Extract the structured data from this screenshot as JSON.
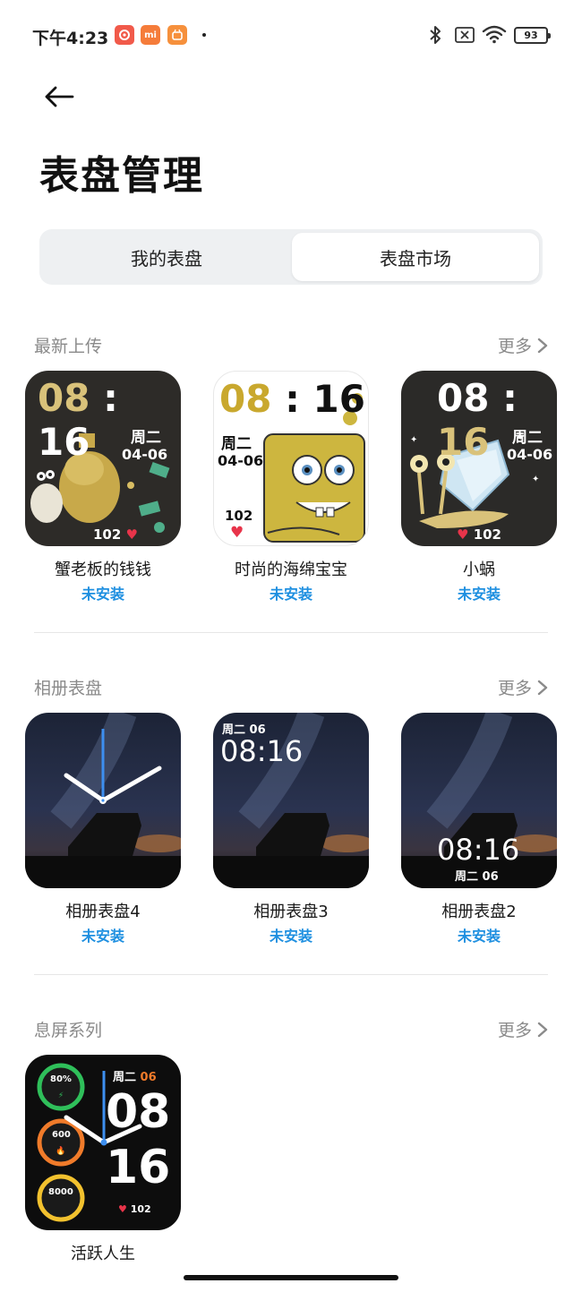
{
  "status_bar": {
    "time": "下午4:23",
    "battery": "93",
    "notif_2_label": "mi"
  },
  "header": {
    "title": "表盘管理"
  },
  "tabs": [
    {
      "label": "我的表盘"
    },
    {
      "label": "表盘市场"
    }
  ],
  "sections": [
    {
      "title": "最新上传",
      "more": "更多",
      "faces": [
        {
          "name": "蟹老板的钱钱",
          "status": "未安装",
          "time_h": "08",
          "time_m": "16",
          "weekday": "周二",
          "date": "04-06",
          "hr": "102"
        },
        {
          "name": "时尚的海绵宝宝",
          "status": "未安装",
          "time_h": "08",
          "time_m": "16",
          "weekday": "周二",
          "date": "04-06",
          "hr": "102"
        },
        {
          "name": "小蜗",
          "status": "未安装",
          "time_h": "08",
          "time_m": "16",
          "weekday": "周二",
          "date": "04-06",
          "hr": "102"
        }
      ]
    },
    {
      "title": "相册表盘",
      "more": "更多",
      "faces": [
        {
          "name": "相册表盘4",
          "status": "未安装"
        },
        {
          "name": "相册表盘3",
          "status": "未安装",
          "weekday": "周二",
          "day": "06",
          "time": "08:16"
        },
        {
          "name": "相册表盘2",
          "status": "未安装",
          "weekday": "周二",
          "day": "06",
          "time": "08:16"
        }
      ]
    },
    {
      "title": "息屏系列",
      "more": "更多",
      "faces": [
        {
          "name": "活跃人生",
          "battery": "80%",
          "calories": "600",
          "steps": "8000",
          "weekday": "周二",
          "day": "06",
          "hour": "08",
          "minute": "16",
          "hr": "102"
        }
      ]
    }
  ],
  "colors": {
    "accent_blue": "#1e8fe0",
    "gold": "#d9c27a",
    "heart_red": "#e8344a"
  }
}
